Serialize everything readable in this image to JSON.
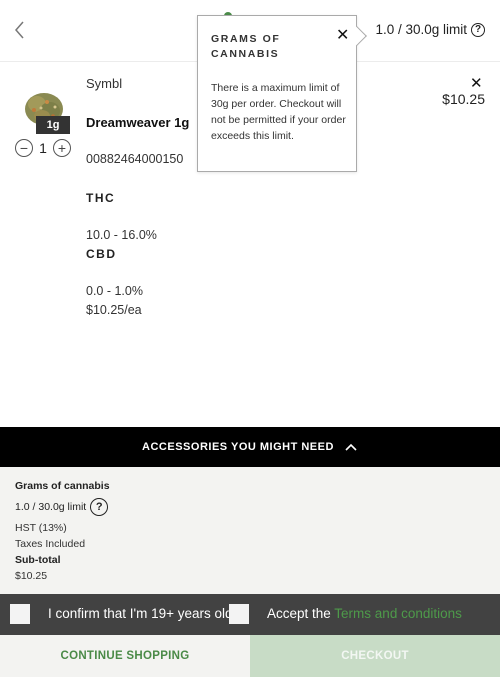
{
  "header": {
    "limit_text": "1.0 / 30.0g limit",
    "help_glyph": "?",
    "back_icon": "chevron-left-icon"
  },
  "tooltip": {
    "title": "GRAMS OF CANNABIS",
    "close_glyph": "✕",
    "body": "There is a maximum limit of 30g per order. Checkout will not be permitted if your order exceeds this limit."
  },
  "item": {
    "brand": "Symbl",
    "name": "Dreamweaver 1g",
    "size_badge": "1g",
    "quantity": "1",
    "sku": "00882464000150",
    "thc_label": "THC",
    "thc_value": "10.0 - 16.0%",
    "cbd_label": "CBD",
    "cbd_value": "0.0 - 1.0%",
    "unit_price": "$10.25/ea",
    "line_price": "$10.25",
    "remove_glyph": "✕",
    "minus_glyph": "−",
    "plus_glyph": "+"
  },
  "accessories": {
    "label": "ACCESSORIES YOU MIGHT NEED",
    "icon": "chevron-up-icon"
  },
  "summary": {
    "grams_label": "Grams of cannabis",
    "limit_text": "1.0 / 30.0g limit",
    "help_glyph": "?",
    "hst": "HST (13%)",
    "taxes": "Taxes Included",
    "subtotal_label": "Sub-total",
    "subtotal_value": "$10.25"
  },
  "confirm": {
    "age_label": "I confirm that I'm 19+ years old",
    "accept_prefix": "Accept the ",
    "terms_link": "Terms and conditions"
  },
  "actions": {
    "continue_label": "CONTINUE SHOPPING",
    "checkout_label": "CHECKOUT"
  },
  "colors": {
    "accent_green": "#4a8a47",
    "checkout_disabled": "#c8dcc6",
    "dark_bar": "#000000",
    "confirm_bar": "#424242"
  }
}
